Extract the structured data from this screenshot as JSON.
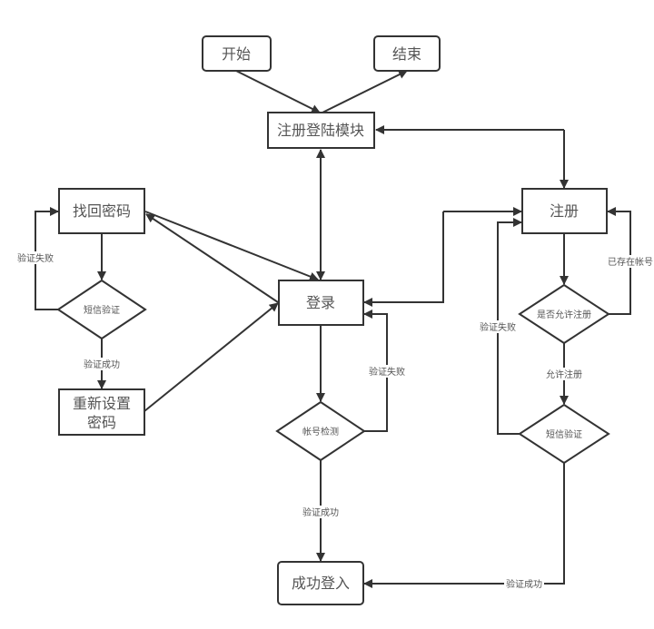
{
  "diagram": {
    "type": "flowchart",
    "nodes": {
      "start": {
        "label": "开始",
        "shape": "rounded-rect"
      },
      "end": {
        "label": "结束",
        "shape": "rounded-rect"
      },
      "module": {
        "label": "注册登陆模块",
        "shape": "rect"
      },
      "recover": {
        "label": "找回密码",
        "shape": "rect"
      },
      "sms_left": {
        "label": "短信验证",
        "shape": "diamond"
      },
      "reset_line1": {
        "label": "重新设置",
        "shape": "rect"
      },
      "reset_line2": {
        "label": "密码"
      },
      "login": {
        "label": "登录",
        "shape": "rect"
      },
      "account_check": {
        "label": "帐号检测",
        "shape": "diamond"
      },
      "login_success": {
        "label": "成功登入",
        "shape": "rounded-rect"
      },
      "register": {
        "label": "注册",
        "shape": "rect"
      },
      "allow_register": {
        "label": "是否允许注册",
        "shape": "diamond"
      },
      "sms_right": {
        "label": "短信验证",
        "shape": "diamond"
      }
    },
    "edge_labels": {
      "left_fail": "验证失败",
      "left_success": "验证成功",
      "login_fail": "验证失败",
      "login_success": "验证成功",
      "exists": "已存在帐号",
      "reg_fail": "验证失败",
      "allowed": "允许注册",
      "reg_success": "验证成功"
    },
    "colors": {
      "stroke": "#333333",
      "text": "#555555",
      "background": "#ffffff"
    }
  }
}
